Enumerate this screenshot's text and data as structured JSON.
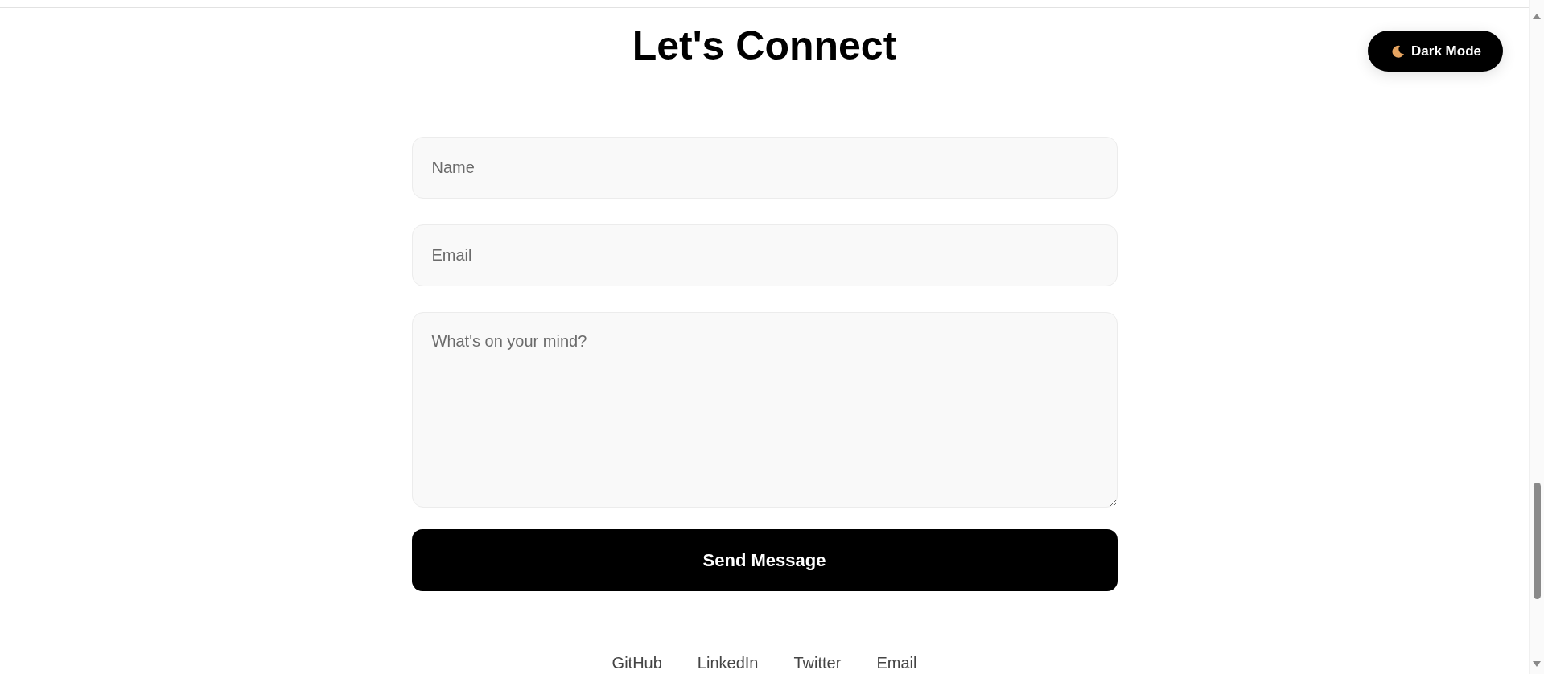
{
  "theme_toggle": {
    "label": "Dark Mode"
  },
  "heading": "Let's Connect",
  "form": {
    "fields": [
      {
        "kind": "input",
        "placeholder": "Name"
      },
      {
        "kind": "input",
        "placeholder": "Email"
      },
      {
        "kind": "textarea",
        "placeholder": "What's on your mind?"
      }
    ],
    "submit": "Send Message"
  },
  "footer_links": [
    "GitHub",
    "LinkedIn",
    "Twitter",
    "Email"
  ]
}
